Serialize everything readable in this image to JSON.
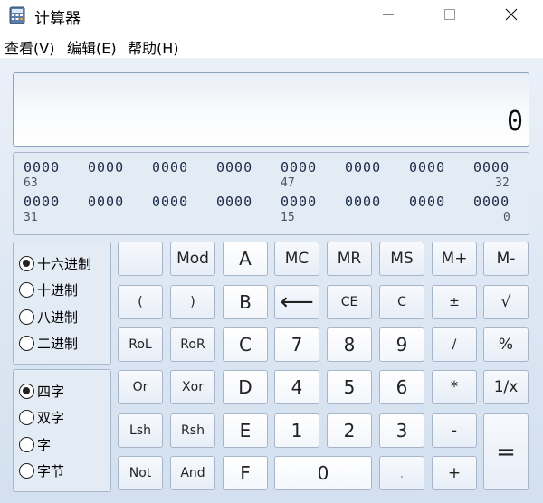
{
  "window": {
    "title": "计算器"
  },
  "menu": [
    {
      "label": "查看(V)"
    },
    {
      "label": "编辑(E)"
    },
    {
      "label": "帮助(H)"
    }
  ],
  "display": {
    "value": "0"
  },
  "bits": {
    "row1": [
      "0000",
      "0000",
      "0000",
      "0000",
      "0000",
      "0000",
      "0000",
      "0000"
    ],
    "row1_indices": [
      "63",
      "47",
      "32"
    ],
    "row2": [
      "0000",
      "0000",
      "0000",
      "0000",
      "0000",
      "0000",
      "0000",
      "0000"
    ],
    "row2_indices": [
      "31",
      "15",
      "0"
    ]
  },
  "base_options": [
    {
      "label": "十六进制",
      "selected": true
    },
    {
      "label": "十进制",
      "selected": false
    },
    {
      "label": "八进制",
      "selected": false
    },
    {
      "label": "二进制",
      "selected": false
    }
  ],
  "size_options": [
    {
      "label": "四字",
      "selected": true
    },
    {
      "label": "双字",
      "selected": false
    },
    {
      "label": "字",
      "selected": false
    },
    {
      "label": "字节",
      "selected": false
    }
  ],
  "keys": {
    "blank": "",
    "mod": "Mod",
    "a": "A",
    "mc": "MC",
    "mr": "MR",
    "ms": "MS",
    "mplus": "M+",
    "mminus": "M-",
    "lparen": "(",
    "rparen": ")",
    "b": "B",
    "backspace": "⟵",
    "ce": "CE",
    "c": "C",
    "plusminus": "±",
    "sqrt": "√",
    "rol": "RoL",
    "ror": "RoR",
    "c_hex": "C",
    "n7": "7",
    "n8": "8",
    "n9": "9",
    "div": "/",
    "pct": "%",
    "or": "Or",
    "xor": "Xor",
    "d": "D",
    "n4": "4",
    "n5": "5",
    "n6": "6",
    "mul": "*",
    "recip": "1/x",
    "lsh": "Lsh",
    "rsh": "Rsh",
    "e": "E",
    "n1": "1",
    "n2": "2",
    "n3": "3",
    "sub": "-",
    "eq": "=",
    "not": "Not",
    "and": "And",
    "f": "F",
    "n0": "0",
    "dot": ".",
    "add": "+"
  }
}
